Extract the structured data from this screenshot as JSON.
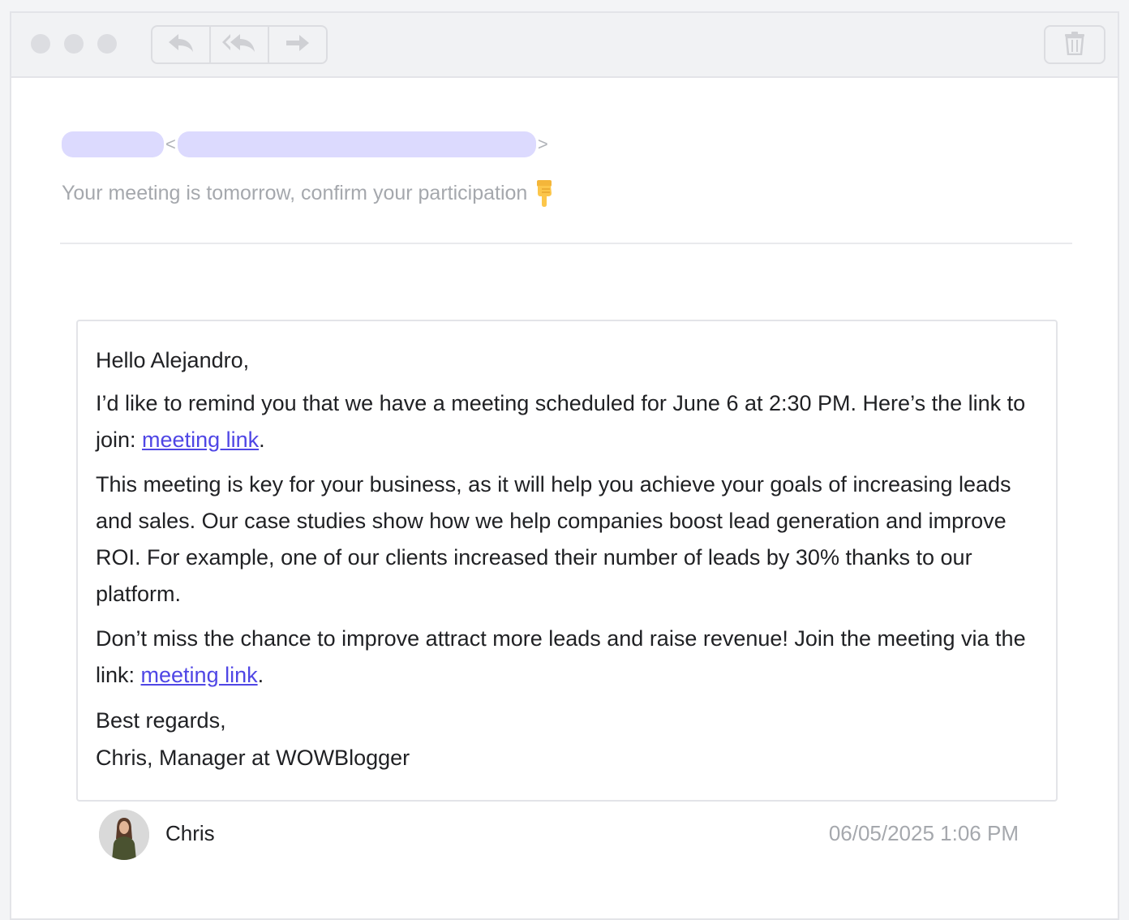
{
  "toolbar": {
    "window_controls": [
      "close",
      "minimize",
      "maximize"
    ],
    "reply_icon": "reply-icon",
    "reply_all_icon": "reply-all-icon",
    "forward_icon": "forward-icon",
    "trash_icon": "trash-icon"
  },
  "header": {
    "sender_open": "<",
    "sender_close": ">",
    "subject": "Your meeting is tomorrow, confirm your participation",
    "subject_emoji_icon": "pointing-down-hand-icon"
  },
  "body": {
    "greeting": "Hello Alejandro,",
    "p1_text": "I’d like to remind you that we have a meeting scheduled for June 6 at 2:30 PM. Here’s the link to join: ",
    "p1_link": "meeting link",
    "p1_end": ".",
    "p2": "This meeting is key for your business, as it will help you achieve your goals of increasing leads and sales. Our case studies show how we help companies boost lead generation and improve ROI. For example, one of our clients increased their number of leads by 30% thanks to our platform.",
    "p3_text": "Don’t miss the chance to improve attract more leads and raise revenue! Join the meeting via the link: ",
    "p3_link": "meeting link",
    "p3_end": ".",
    "closing": "Best regards,",
    "signature": "Chris, Manager at WOWBlogger"
  },
  "footer": {
    "name": "Chris",
    "date": "06/05/2025 1:06 PM"
  },
  "colors": {
    "link": "#4f46e5",
    "redaction": "#dcdafe",
    "muted_text": "#a5a8ad"
  }
}
